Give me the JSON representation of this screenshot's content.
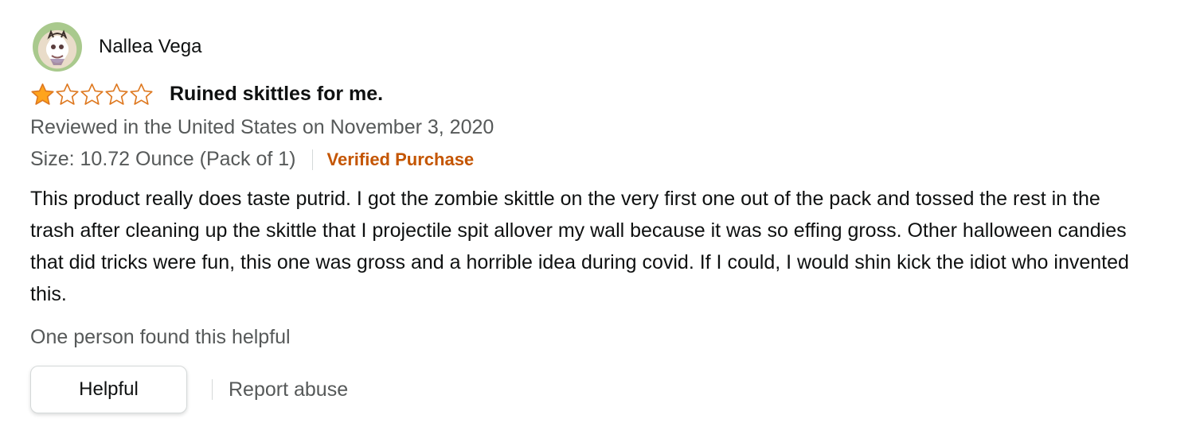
{
  "profile": {
    "name": "Nallea Vega"
  },
  "review": {
    "rating": 1,
    "rating_max": 5,
    "title": "Ruined skittles for me.",
    "date": "Reviewed in the United States on November 3, 2020",
    "variant": "Size: 10.72 Ounce (Pack of 1)",
    "verified": "Verified Purchase",
    "body": "This product really does taste putrid. I got the zombie skittle on the very first one out of the pack and tossed the rest in the trash after cleaning up the skittle that I projectile spit allover my wall because it was so effing gross. Other halloween candies that did tricks were fun, this one was gross and a horrible idea during covid. If I could, I would shin kick the idiot who invented this."
  },
  "helpful_count_text": "One person found this helpful",
  "actions": {
    "helpful_label": "Helpful",
    "report_label": "Report abuse"
  },
  "colors": {
    "star": "#ffa41c",
    "star_outline": "#de7921",
    "verified": "#c45500",
    "muted": "#565959"
  }
}
